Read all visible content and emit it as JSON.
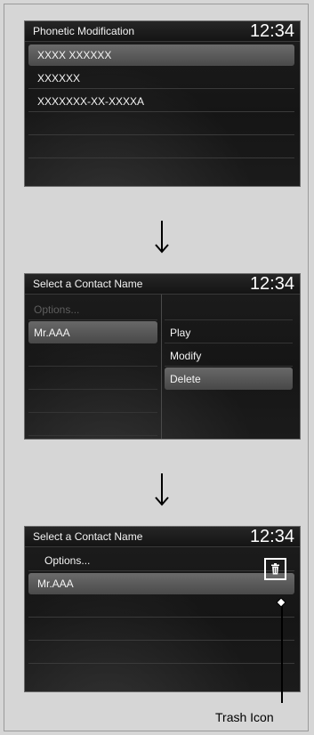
{
  "screen1": {
    "title": "Phonetic Modification",
    "clock": "12:34",
    "items": [
      "XXXX XXXXXX",
      "XXXXXX",
      "XXXXXXX-XX-XXXXA"
    ]
  },
  "screen2": {
    "title": "Select a Contact Name",
    "clock": "12:34",
    "left_items": [
      "Options...",
      "Mr.AAA"
    ],
    "right_items": [
      "Play",
      "Modify",
      "Delete"
    ]
  },
  "screen3": {
    "title": "Select a Contact Name",
    "clock": "12:34",
    "items": [
      "Options...",
      "Mr.AAA"
    ]
  },
  "callout": {
    "label": "Trash Icon"
  },
  "colors": {
    "screen_bg": "#171717",
    "highlight": "#5a5a5a",
    "page_bg": "#d6d6d6"
  }
}
